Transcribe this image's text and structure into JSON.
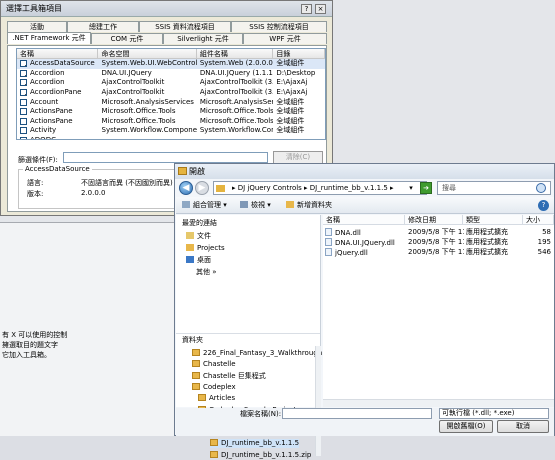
{
  "background": {
    "hint_text": "有 X 可以使用的控制\n擁選取目的題文字\n它加入工具箱。"
  },
  "toolbox": {
    "title": "選擇工具箱項目",
    "help": "?",
    "close": "×",
    "tabs_row1": [
      "活動",
      "總建工作",
      "SSIS 資料流程項目",
      "SSIS 控制流程項目"
    ],
    "tabs_row2": [
      ".NET Framework 元件",
      "COM 元件",
      "Silverlight 元件",
      "WPF 元件"
    ],
    "columns": [
      "名稱",
      "命名空間",
      "組件名稱",
      "目錄"
    ],
    "rows": [
      {
        "checked": true,
        "name": "AccessDataSource",
        "ns": "System.Web.UI.WebControls",
        "asm": "System.Web (2.0.0.0)",
        "dir": "全域組件"
      },
      {
        "checked": true,
        "name": "Accordion",
        "ns": "DNA.UI.JQuery",
        "asm": "DNA.UI.JQuery (1.1.15....",
        "dir": "D:\\Desktop"
      },
      {
        "checked": true,
        "name": "Accordion",
        "ns": "AjaxControlToolkit",
        "asm": "AjaxControlToolkit (3.0....",
        "dir": "E:\\AjaxAj"
      },
      {
        "checked": true,
        "name": "AccordionPane",
        "ns": "AjaxControlToolkit",
        "asm": "AjaxControlToolkit (3.0....",
        "dir": "E:\\AjaxAj"
      },
      {
        "checked": false,
        "name": "Account",
        "ns": "Microsoft.AnalysisServices",
        "asm": "Microsoft.AnalysisServic...",
        "dir": "全域組件"
      },
      {
        "checked": false,
        "name": "ActionsPane",
        "ns": "Microsoft.Office.Tools",
        "asm": "Microsoft.Office.Tools....",
        "dir": "全域組件"
      },
      {
        "checked": false,
        "name": "ActionsPane",
        "ns": "Microsoft.Office.Tools",
        "asm": "Microsoft.Office.Tools....",
        "dir": "全域組件"
      },
      {
        "checked": false,
        "name": "Activity",
        "ns": "System.Workflow.ComponentM...",
        "asm": "System.Workflow.Comp...",
        "dir": "全域組件"
      },
      {
        "checked": false,
        "name": "ADODC",
        "ns": "",
        "asm": "",
        "dir": ""
      }
    ],
    "filter_label": "篩選條件(F):",
    "filter_value": "",
    "clear_button": "清除(C)",
    "group_title": "AccessDataSource",
    "language_label": "語言:",
    "language_value": "不固語言而異 (不因國別而異)",
    "version_label": "版本:",
    "version_value": "2.0.0.0"
  },
  "open_dialog": {
    "title": "開啟",
    "back": "◀",
    "forward": "▶",
    "address": "▸ DJ jQuery Controls ▸ DJ_runtime_bb_v.1.1.5 ▸",
    "address_dd": "▾",
    "go": "➔",
    "search_placeholder": "搜尋",
    "toolbar": {
      "organize": "組合管理 ▾",
      "views": "檢視 ▾",
      "new_folder": "新增資料夾"
    },
    "help": "?",
    "favorites_header": "最愛的連結",
    "favorites": [
      "文件",
      "Projects",
      "桌面",
      "其他 »"
    ],
    "folders_header": "資料夾",
    "tree": [
      {
        "label": "226_Final_Fantasy_3_Walkthrough",
        "level": 0
      },
      {
        "label": "Chastelle",
        "level": 0
      },
      {
        "label": "Chastelle 巨集程式",
        "level": 0
      },
      {
        "label": "Codeplex",
        "level": 0
      },
      {
        "label": "Articles",
        "level": 1
      },
      {
        "label": "Codeplex Sample Projects",
        "level": 1
      },
      {
        "label": "Packages",
        "level": 1
      },
      {
        "label": "DJ jQuery Controls",
        "level": 2
      },
      {
        "label": "DJ_runtime_bb_v.1.1.5",
        "level": 3
      },
      {
        "label": "DJ_runtime_bb_v.1.1.5.zip",
        "level": 3
      }
    ],
    "file_columns": [
      "名稱",
      "修改日期",
      "類型",
      "大小"
    ],
    "files": [
      {
        "name": "DNA.dll",
        "date": "2009/5/8 下午 11...",
        "type": "應用程式擴充",
        "size": "58"
      },
      {
        "name": "DNA.UI.JQuery.dll",
        "date": "2009/5/8 下午 11...",
        "type": "應用程式擴充",
        "size": "195"
      },
      {
        "name": "jQuery.dll",
        "date": "2009/5/8 下午 11...",
        "type": "應用程式擴充",
        "size": "546"
      }
    ],
    "filename_label": "檔案名稱(N):",
    "filename_value": "",
    "filetype_value": "可執行檔 (*.dll; *.exe)",
    "open_button": "開啟舊檔(O)",
    "cancel_button": "取消"
  }
}
